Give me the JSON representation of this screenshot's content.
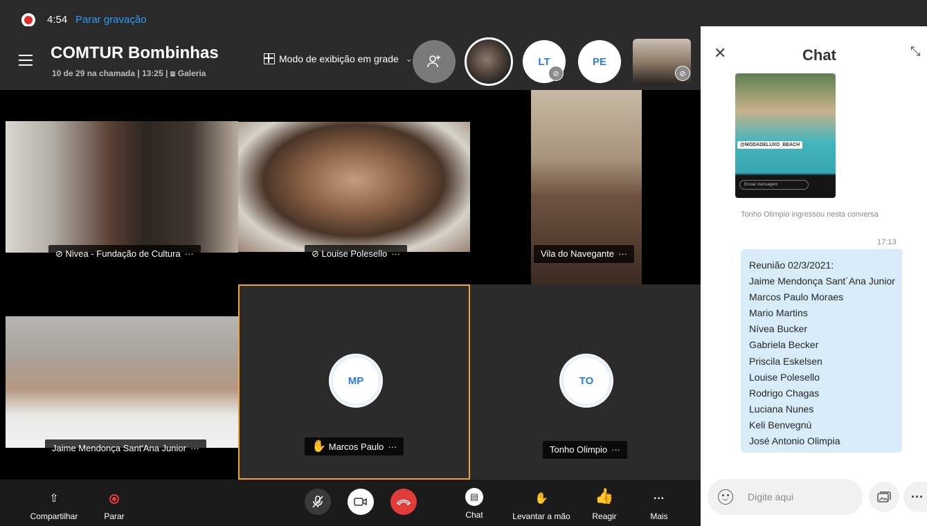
{
  "recording": {
    "time": "4:54",
    "stop_label": "Parar gravação"
  },
  "header": {
    "title": "COMTUR Bombinhas",
    "subtitle": "10 de 29 na chamada | 13:25 | ⧈ Galeria",
    "view_mode": "Modo de exibição em grade"
  },
  "participants_bar": [
    {
      "type": "photo"
    },
    {
      "type": "initials",
      "initials": "LT",
      "muted": true
    },
    {
      "type": "initials",
      "initials": "PE",
      "muted": false
    },
    {
      "type": "photo",
      "muted": true
    }
  ],
  "tiles": [
    {
      "name": "Nivea - Fundação de Cultura",
      "muted": true
    },
    {
      "name": "Louise Polesello",
      "muted": true
    },
    {
      "name": "Vila do Navegante",
      "muted": false
    },
    {
      "name": "Jaime Mendonça Sant'Ana Junior",
      "muted": false
    },
    {
      "name": "Marcos Paulo",
      "initials": "MP",
      "hand_raised": true
    },
    {
      "name": "Tonho Olimpio",
      "initials": "TO"
    }
  ],
  "toolbar": {
    "share": "Compartilhar",
    "stop": "Parar",
    "chat": "Chat",
    "raise_hand": "Levantar a mão",
    "react": "Reagir",
    "more": "Mais"
  },
  "chat": {
    "title": "Chat",
    "image_tag": "@MODADELUXO_BEACH",
    "image_input": "Enviar mensagem",
    "system_message": "Tonho Olimpio ingressou nesta conversa",
    "time": "17:13",
    "message_lines": [
      "Reunião 02/3/2021:",
      "Jaime Mendonça Sant´Ana Junior",
      "Marcos Paulo Moraes",
      "Mario Martins",
      "Nívea Bucker",
      "Gabriela Becker",
      "Priscila Eskelsen",
      "Louise Polesello",
      "Rodrigo Chagas",
      "Luciana Nunes",
      "Keli Benvegnú",
      "José Antonio Olimpia"
    ],
    "input_placeholder": "Digite aqui"
  }
}
